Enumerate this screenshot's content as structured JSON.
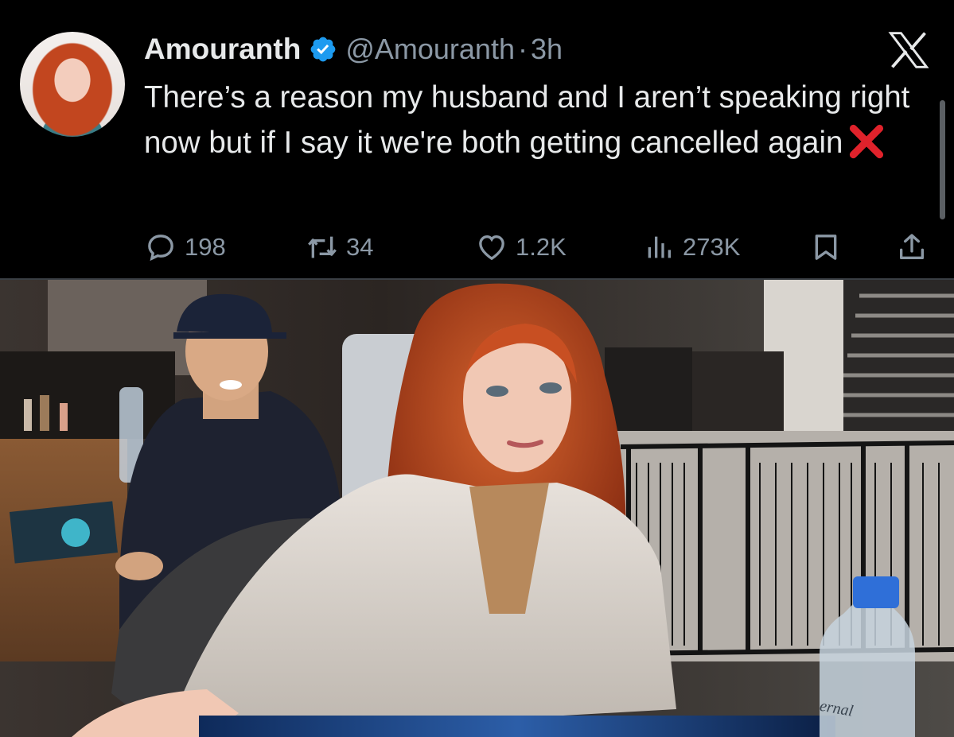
{
  "tweet": {
    "author_name": "Amouranth",
    "handle": "@Amouranth",
    "separator": "·",
    "time": "3h",
    "text": "There’s a reason my husband and I aren’t speaking right now but if I say it we're both getting cancelled again",
    "stats": {
      "replies": "198",
      "retweets": "34",
      "likes": "1.2K",
      "views": "273K"
    }
  },
  "photo": {
    "bottle_label": "ernal"
  },
  "icons": {
    "verified": "verified-badge-icon",
    "platform": "x-logo-icon",
    "inline_emoji": "red-cross-mark-icon",
    "reply": "reply-icon",
    "retweet": "retweet-icon",
    "like": "heart-icon",
    "views": "views-icon",
    "bookmark": "bookmark-icon",
    "share": "share-icon"
  },
  "colors": {
    "background": "#000000",
    "text": "#e7e9ea",
    "secondary_text": "#8b98a5",
    "verified": "#1d9bf0",
    "red_cross": "#e0222b"
  }
}
